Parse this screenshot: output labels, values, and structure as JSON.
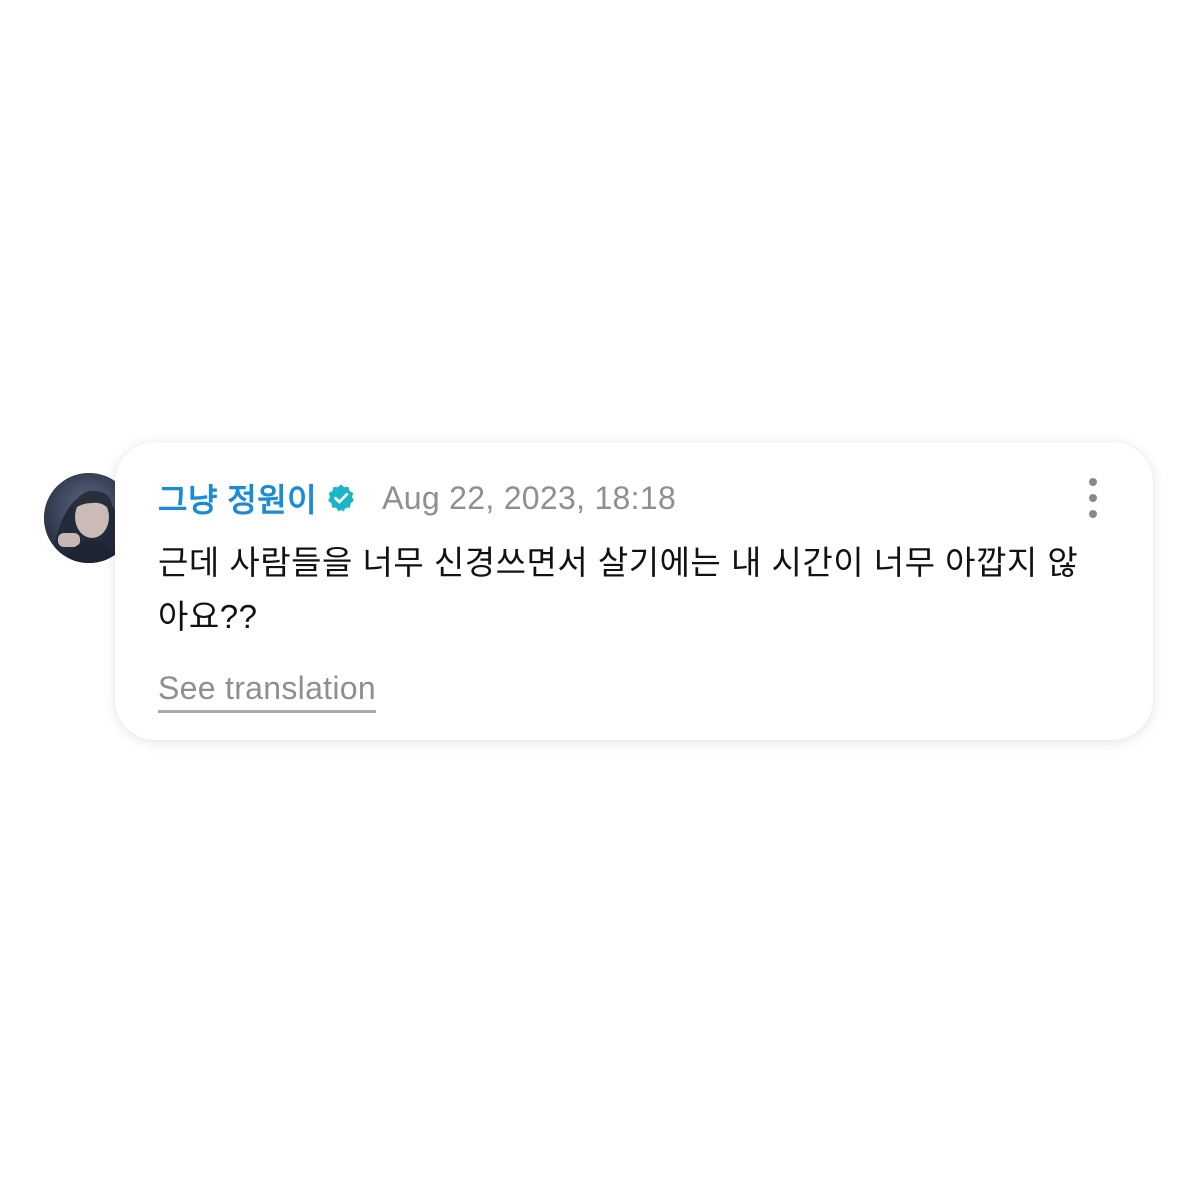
{
  "comment": {
    "author": "그냥 정원이",
    "verified_icon": "verified-badge-icon",
    "timestamp": "Aug 22, 2023, 18:18",
    "message": "근데 사람들을 너무 신경쓰면서 살기에는 내 시간이 너무 아깝지 않아요??",
    "see_translation": "See translation",
    "more_icon": "more-vertical-icon"
  },
  "colors": {
    "author": "#1a8bd6",
    "verified_badge": "#19b6c8",
    "timestamp": "#8e8e93",
    "message": "#111111",
    "background": "#ffffff"
  }
}
